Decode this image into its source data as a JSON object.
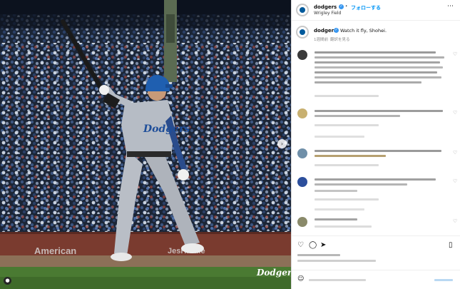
{
  "post": {
    "account": "dodgers",
    "follow_label": "フォローする",
    "location": "Wrigley Field",
    "more_icon": "more-options-icon",
    "caption_user": "dodgers",
    "caption_text": "Watch it fly, Shohei.",
    "time_ago": "1週間前",
    "translate_label": "翻訳を見る"
  },
  "photo": {
    "jersey_text": "Dodgers",
    "ad_left": "American",
    "ad_right": "JesHardie",
    "wordmark": "Dodgers"
  },
  "colors": {
    "accent": "#0095f6",
    "verified": "#3897f0",
    "dodger_blue": "#005a9c"
  }
}
